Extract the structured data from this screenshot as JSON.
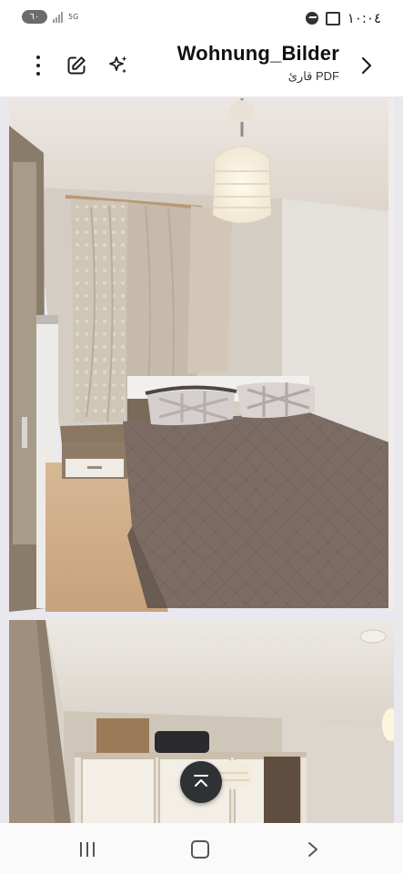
{
  "status_bar": {
    "time": "١٠:٠٤",
    "battery": "٦٠",
    "network": "5G"
  },
  "header": {
    "title": "Wohnung_Bilder",
    "subtitle": "قارئ PDF"
  },
  "icons": {
    "more": "more-vertical-icon",
    "edit": "edit-pencil-icon",
    "ai": "sparkle-ai-icon",
    "next": "chevron-right-icon",
    "scroll_top": "scroll-to-top-icon"
  },
  "colors": {
    "background": "#e9e8ef",
    "header": "#ffffff",
    "fab": "#2f3235"
  }
}
